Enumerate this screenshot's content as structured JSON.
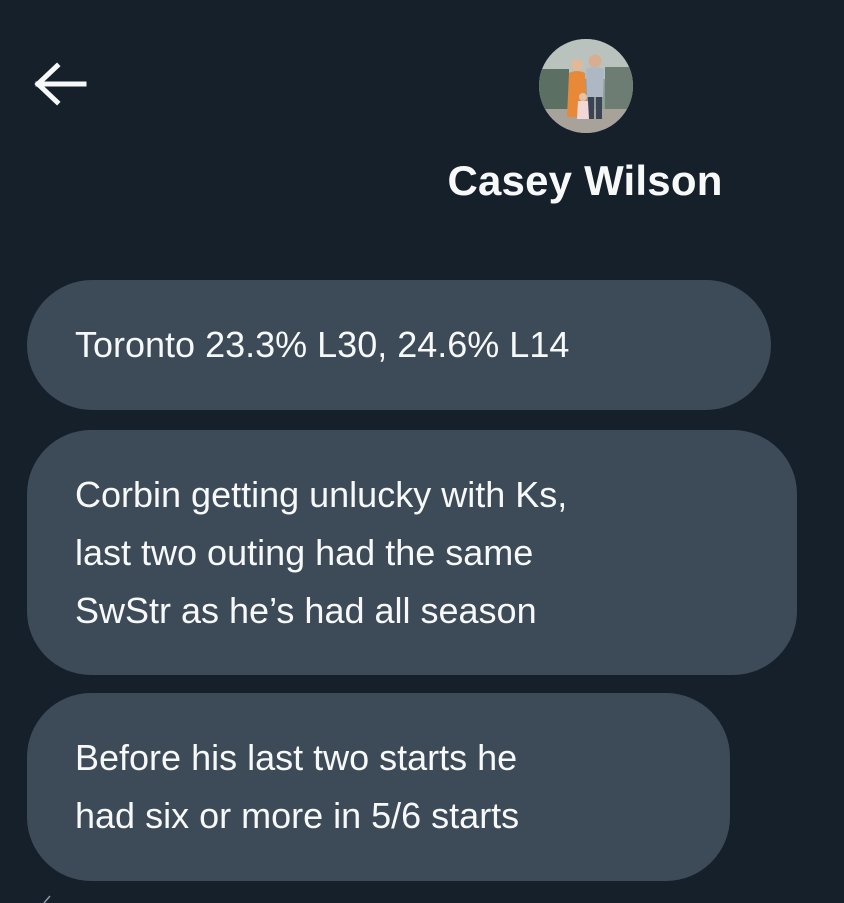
{
  "header": {
    "back_icon": "arrow-left-icon",
    "avatar_icon": "profile-photo",
    "contact_name": "Casey Wilson"
  },
  "messages": [
    {
      "lines": [
        "Toronto 23.3% L30, 24.6% L14"
      ]
    },
    {
      "lines": [
        "Corbin getting unlucky with Ks,",
        "last two outing had the same",
        "SwStr as he’s had all season"
      ]
    },
    {
      "lines": [
        "Before his last two starts he",
        "had six or more in 5/6 starts"
      ]
    }
  ],
  "colors": {
    "background": "#15202b",
    "bubble": "#3d4a58",
    "text": "#f7f9f9"
  }
}
